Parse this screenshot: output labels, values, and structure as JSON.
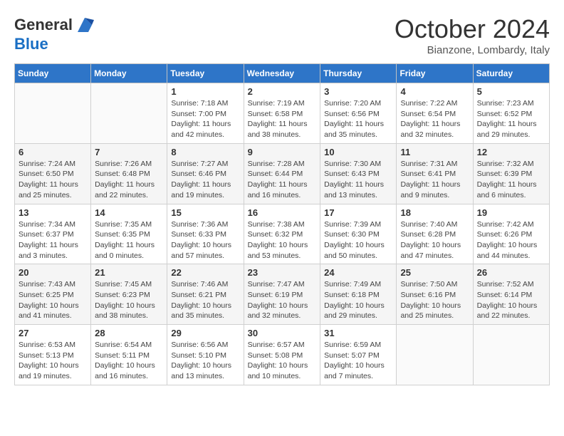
{
  "header": {
    "logo_general": "General",
    "logo_blue": "Blue",
    "title": "October 2024",
    "location": "Bianzone, Lombardy, Italy"
  },
  "weekdays": [
    "Sunday",
    "Monday",
    "Tuesday",
    "Wednesday",
    "Thursday",
    "Friday",
    "Saturday"
  ],
  "weeks": [
    [
      {
        "day": "",
        "detail": ""
      },
      {
        "day": "",
        "detail": ""
      },
      {
        "day": "1",
        "detail": "Sunrise: 7:18 AM\nSunset: 7:00 PM\nDaylight: 11 hours and 42 minutes."
      },
      {
        "day": "2",
        "detail": "Sunrise: 7:19 AM\nSunset: 6:58 PM\nDaylight: 11 hours and 38 minutes."
      },
      {
        "day": "3",
        "detail": "Sunrise: 7:20 AM\nSunset: 6:56 PM\nDaylight: 11 hours and 35 minutes."
      },
      {
        "day": "4",
        "detail": "Sunrise: 7:22 AM\nSunset: 6:54 PM\nDaylight: 11 hours and 32 minutes."
      },
      {
        "day": "5",
        "detail": "Sunrise: 7:23 AM\nSunset: 6:52 PM\nDaylight: 11 hours and 29 minutes."
      }
    ],
    [
      {
        "day": "6",
        "detail": "Sunrise: 7:24 AM\nSunset: 6:50 PM\nDaylight: 11 hours and 25 minutes."
      },
      {
        "day": "7",
        "detail": "Sunrise: 7:26 AM\nSunset: 6:48 PM\nDaylight: 11 hours and 22 minutes."
      },
      {
        "day": "8",
        "detail": "Sunrise: 7:27 AM\nSunset: 6:46 PM\nDaylight: 11 hours and 19 minutes."
      },
      {
        "day": "9",
        "detail": "Sunrise: 7:28 AM\nSunset: 6:44 PM\nDaylight: 11 hours and 16 minutes."
      },
      {
        "day": "10",
        "detail": "Sunrise: 7:30 AM\nSunset: 6:43 PM\nDaylight: 11 hours and 13 minutes."
      },
      {
        "day": "11",
        "detail": "Sunrise: 7:31 AM\nSunset: 6:41 PM\nDaylight: 11 hours and 9 minutes."
      },
      {
        "day": "12",
        "detail": "Sunrise: 7:32 AM\nSunset: 6:39 PM\nDaylight: 11 hours and 6 minutes."
      }
    ],
    [
      {
        "day": "13",
        "detail": "Sunrise: 7:34 AM\nSunset: 6:37 PM\nDaylight: 11 hours and 3 minutes."
      },
      {
        "day": "14",
        "detail": "Sunrise: 7:35 AM\nSunset: 6:35 PM\nDaylight: 11 hours and 0 minutes."
      },
      {
        "day": "15",
        "detail": "Sunrise: 7:36 AM\nSunset: 6:33 PM\nDaylight: 10 hours and 57 minutes."
      },
      {
        "day": "16",
        "detail": "Sunrise: 7:38 AM\nSunset: 6:32 PM\nDaylight: 10 hours and 53 minutes."
      },
      {
        "day": "17",
        "detail": "Sunrise: 7:39 AM\nSunset: 6:30 PM\nDaylight: 10 hours and 50 minutes."
      },
      {
        "day": "18",
        "detail": "Sunrise: 7:40 AM\nSunset: 6:28 PM\nDaylight: 10 hours and 47 minutes."
      },
      {
        "day": "19",
        "detail": "Sunrise: 7:42 AM\nSunset: 6:26 PM\nDaylight: 10 hours and 44 minutes."
      }
    ],
    [
      {
        "day": "20",
        "detail": "Sunrise: 7:43 AM\nSunset: 6:25 PM\nDaylight: 10 hours and 41 minutes."
      },
      {
        "day": "21",
        "detail": "Sunrise: 7:45 AM\nSunset: 6:23 PM\nDaylight: 10 hours and 38 minutes."
      },
      {
        "day": "22",
        "detail": "Sunrise: 7:46 AM\nSunset: 6:21 PM\nDaylight: 10 hours and 35 minutes."
      },
      {
        "day": "23",
        "detail": "Sunrise: 7:47 AM\nSunset: 6:19 PM\nDaylight: 10 hours and 32 minutes."
      },
      {
        "day": "24",
        "detail": "Sunrise: 7:49 AM\nSunset: 6:18 PM\nDaylight: 10 hours and 29 minutes."
      },
      {
        "day": "25",
        "detail": "Sunrise: 7:50 AM\nSunset: 6:16 PM\nDaylight: 10 hours and 25 minutes."
      },
      {
        "day": "26",
        "detail": "Sunrise: 7:52 AM\nSunset: 6:14 PM\nDaylight: 10 hours and 22 minutes."
      }
    ],
    [
      {
        "day": "27",
        "detail": "Sunrise: 6:53 AM\nSunset: 5:13 PM\nDaylight: 10 hours and 19 minutes."
      },
      {
        "day": "28",
        "detail": "Sunrise: 6:54 AM\nSunset: 5:11 PM\nDaylight: 10 hours and 16 minutes."
      },
      {
        "day": "29",
        "detail": "Sunrise: 6:56 AM\nSunset: 5:10 PM\nDaylight: 10 hours and 13 minutes."
      },
      {
        "day": "30",
        "detail": "Sunrise: 6:57 AM\nSunset: 5:08 PM\nDaylight: 10 hours and 10 minutes."
      },
      {
        "day": "31",
        "detail": "Sunrise: 6:59 AM\nSunset: 5:07 PM\nDaylight: 10 hours and 7 minutes."
      },
      {
        "day": "",
        "detail": ""
      },
      {
        "day": "",
        "detail": ""
      }
    ]
  ]
}
